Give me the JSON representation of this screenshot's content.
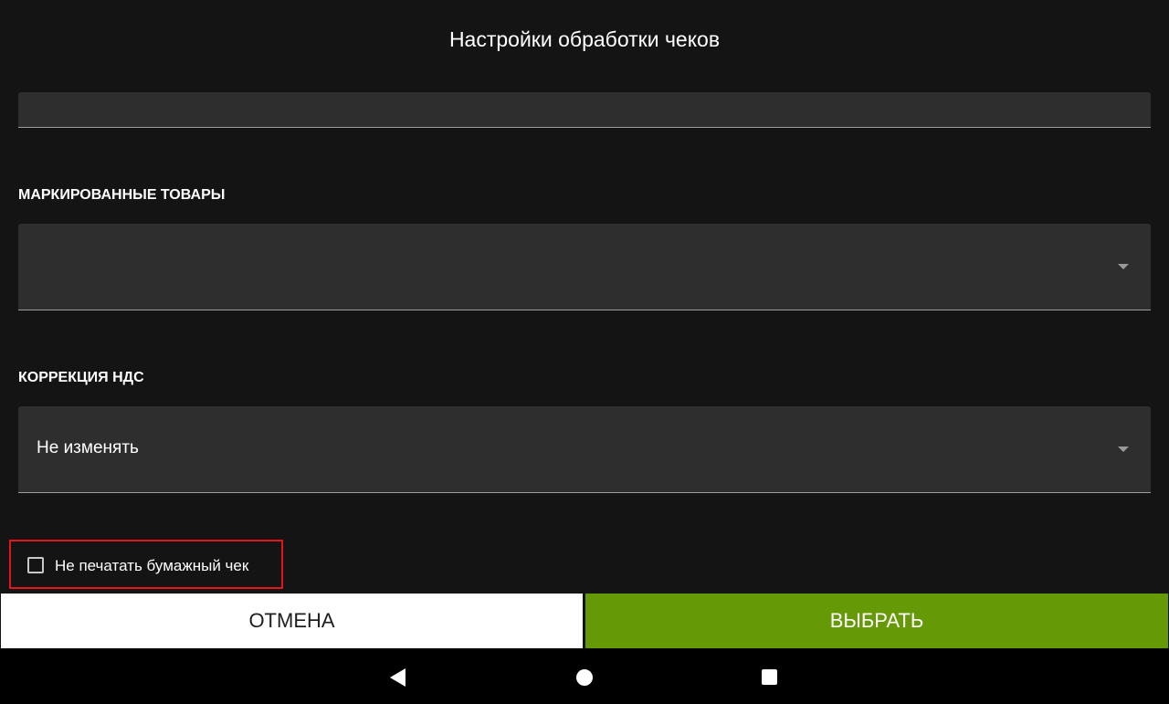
{
  "dialog": {
    "title": "Настройки обработки чеков"
  },
  "fields": {
    "top_field_value": "",
    "marked_goods": {
      "label": "МАРКИРОВАННЫЕ ТОВАРЫ",
      "value": ""
    },
    "vat_correction": {
      "label": "КОРРЕКЦИЯ НДС",
      "value": "Не изменять"
    }
  },
  "checkbox": {
    "label": "Не печатать бумажный чек",
    "checked": false
  },
  "buttons": {
    "cancel_label": "ОТМЕНА",
    "select_label": "ВЫБРАТЬ"
  },
  "navbar": {
    "icons": [
      "back-icon",
      "home-icon",
      "recents-icon"
    ]
  },
  "colors": {
    "background": "#141414",
    "field": "#2e2e2e",
    "accent_green": "#659a06",
    "highlight_red": "#e3141b"
  }
}
